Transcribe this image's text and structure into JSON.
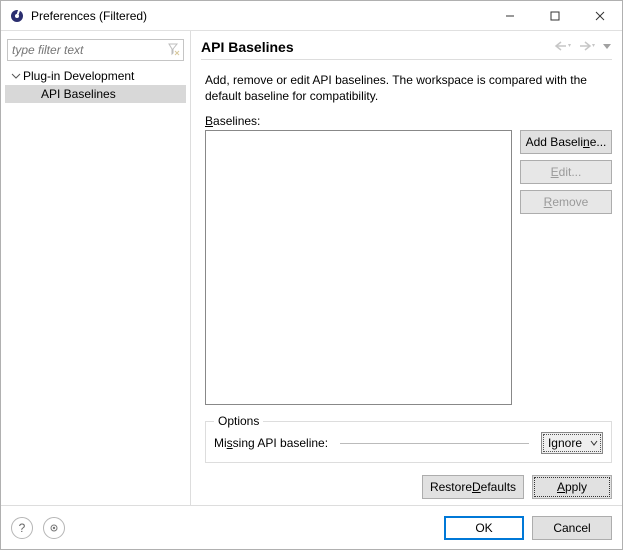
{
  "window": {
    "title": "Preferences (Filtered)"
  },
  "sidebar": {
    "filter_placeholder": "type filter text",
    "items": [
      {
        "label": "Plug-in Development"
      },
      {
        "label": "API Baselines"
      }
    ]
  },
  "main": {
    "heading": "API Baselines",
    "description": "Add, remove or edit API baselines. The workspace is compared with the default baseline for compatibility.",
    "baselines_label": "Baselines:",
    "buttons": {
      "add": "Add Baseline...",
      "edit": "Edit...",
      "remove": "Remove"
    },
    "options": {
      "group_title": "Options",
      "missing_label": "Missing API baseline:",
      "missing_value": "Ignore"
    },
    "footer_section": {
      "restore": "Restore Defaults",
      "apply": "Apply"
    }
  },
  "footer": {
    "ok": "OK",
    "cancel": "Cancel"
  }
}
